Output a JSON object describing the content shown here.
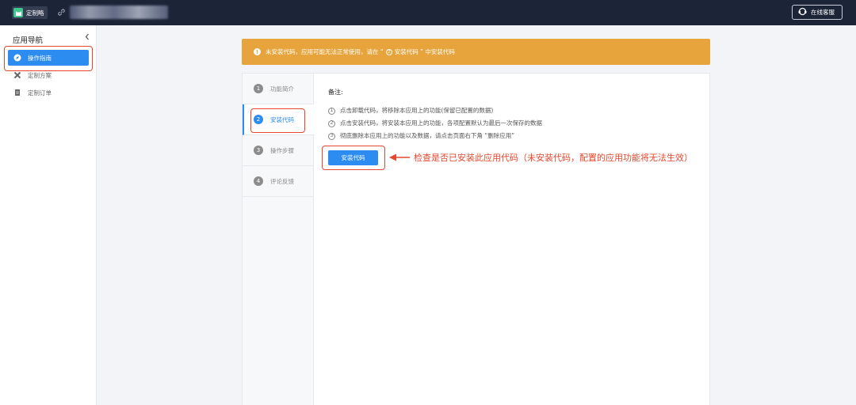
{
  "topbar": {
    "brand_name": "定制略",
    "support_label": "在线客服"
  },
  "sidebar": {
    "title": "应用导航",
    "items": [
      {
        "label": "操作指南",
        "icon": "compass-icon",
        "active": true
      },
      {
        "label": "定制方案",
        "icon": "tools-icon",
        "active": false
      },
      {
        "label": "定制订单",
        "icon": "document-icon",
        "active": false
      }
    ]
  },
  "alert": {
    "text_before": "未安装代码，应用可能无法正常使用，请在 “",
    "step_num": "2",
    "text_after": "安装代码 ” 中安装代码"
  },
  "steps": [
    {
      "num": "1",
      "label": "功能简介"
    },
    {
      "num": "2",
      "label": "安装代码"
    },
    {
      "num": "3",
      "label": "操作步骤"
    },
    {
      "num": "4",
      "label": "评论反馈"
    }
  ],
  "notes": {
    "title": "备注:",
    "lines": [
      {
        "num": "1",
        "text": "点击卸载代码，将移除本应用上的功能(保留已配置的数据)"
      },
      {
        "num": "2",
        "text": "点击安装代码，将安装本应用上的功能，各项配置默认为最后一次保存的数据"
      },
      {
        "num": "3",
        "text": "彻底删除本应用上的功能以及数据，请点击页面右下角 “删除应用”"
      }
    ]
  },
  "install_button_label": "安装代码",
  "annotation": "检查是否已安装此应用代码（未安装代码，配置的应用功能将无法生效）",
  "colors": {
    "topbar": "#1c2438",
    "accent": "#2d8cf0",
    "warning": "#e8a43c",
    "highlight": "#e5482e"
  }
}
